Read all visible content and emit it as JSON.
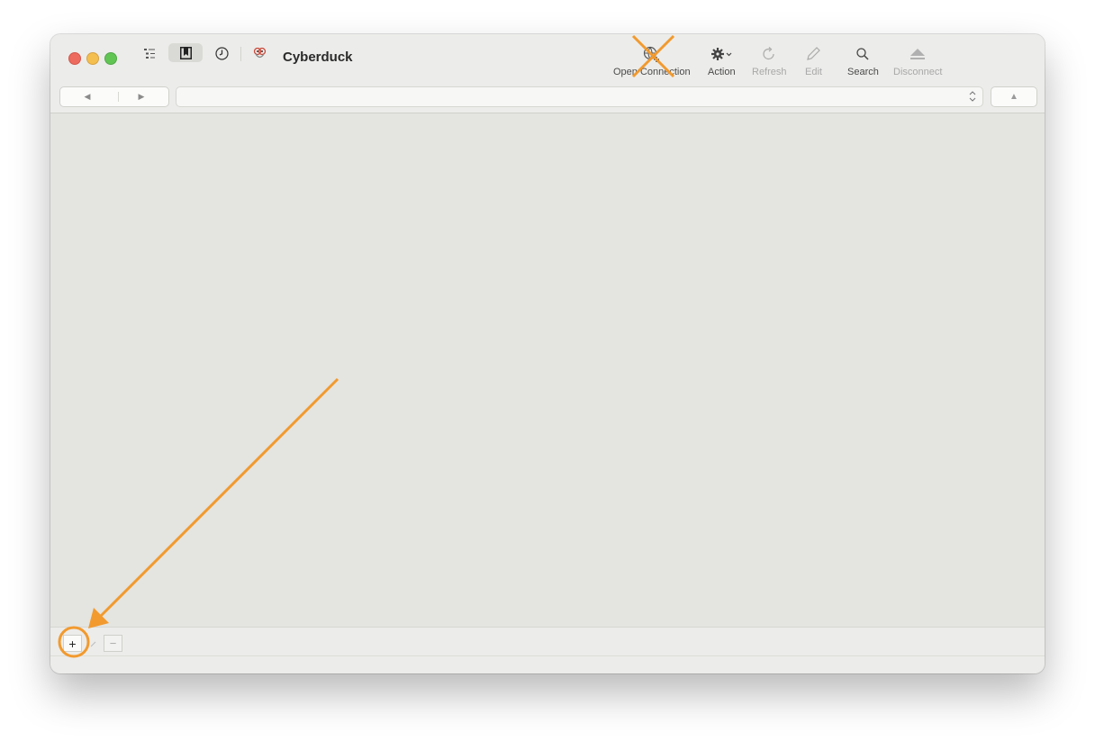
{
  "window": {
    "title": "Cyberduck"
  },
  "sidebar_toggles": [
    {
      "name": "outline-view",
      "icon": "outline-list-icon"
    },
    {
      "name": "bookmarks",
      "icon": "bookmark-icon",
      "selected": true
    },
    {
      "name": "history",
      "icon": "clock-icon"
    }
  ],
  "toolbar": {
    "open_connection": "Open Connection",
    "action": "Action",
    "refresh": "Refresh",
    "edit": "Edit",
    "search": "Search",
    "disconnect": "Disconnect"
  },
  "navigation": {
    "back": "◀",
    "forward": "▶",
    "up": "▲",
    "path": ""
  },
  "bottom_buttons": {
    "add": "+",
    "delete": "−"
  },
  "annotations": {
    "color": "#f29a2e",
    "cross_target": "open-connection",
    "arrow_target": "add-bookmark"
  },
  "colors": {
    "red": "#ed6a5e",
    "yellow": "#f5bf4f",
    "green": "#61c554",
    "accent": "#f29a2e"
  }
}
